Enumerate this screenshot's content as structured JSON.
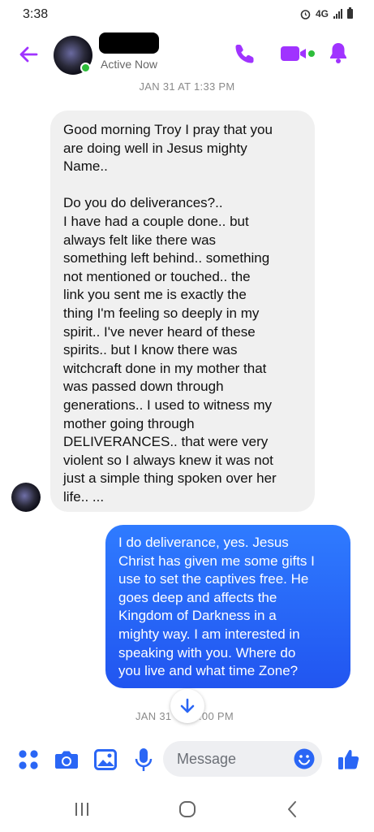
{
  "status_bar": {
    "time": "3:38",
    "network": "4G"
  },
  "header": {
    "presence": "Active Now"
  },
  "chat": {
    "timestamp_top": "JAN 31 AT 1:33 PM",
    "incoming_message": "Good morning Troy I pray that you\nare doing well in Jesus mighty\nName..\n\nDo you do deliverances?..\nI have had a couple done.. but\nalways felt like there was\nsomething left behind.. something\nnot mentioned or touched.. the\nlink you sent me is exactly the\nthing I'm feeling so deeply in my\nspirit.. I've never heard of these\nspirits.. but I know there was\nwitchcraft done in my mother that\nwas passed down through\ngenerations.. I used to witness my\nmother going through\nDELIVERANCES.. that were very\nviolent so I always knew it was not\njust a simple thing spoken over her\nlife.. ...",
    "outgoing_message": "I do deliverance, yes.  Jesus\nChrist has given me some gifts I\nuse to set the captives free.  He\ngoes deep and affects the\nKingdom of Darkness in a\nmighty way.  I am interested in\nspeaking with you.  Where do\nyou live and what time Zone?",
    "timestamp_bottom_left": "JAN 31",
    "timestamp_bottom_right": ":00 PM"
  },
  "composer": {
    "placeholder": "Message"
  },
  "colors": {
    "accent": "#a033ff",
    "outgoing_bubble": "#2a66f5",
    "incoming_bubble": "#f0f0f0",
    "online": "#2dbd3a"
  },
  "icons": [
    "back-arrow-icon",
    "phone-icon",
    "video-icon",
    "bell-icon",
    "menu-dots-icon",
    "camera-icon",
    "image-icon",
    "microphone-icon",
    "emoji-icon",
    "thumbs-up-icon",
    "scroll-down-icon",
    "recent-apps-icon",
    "home-icon",
    "nav-back-icon"
  ]
}
